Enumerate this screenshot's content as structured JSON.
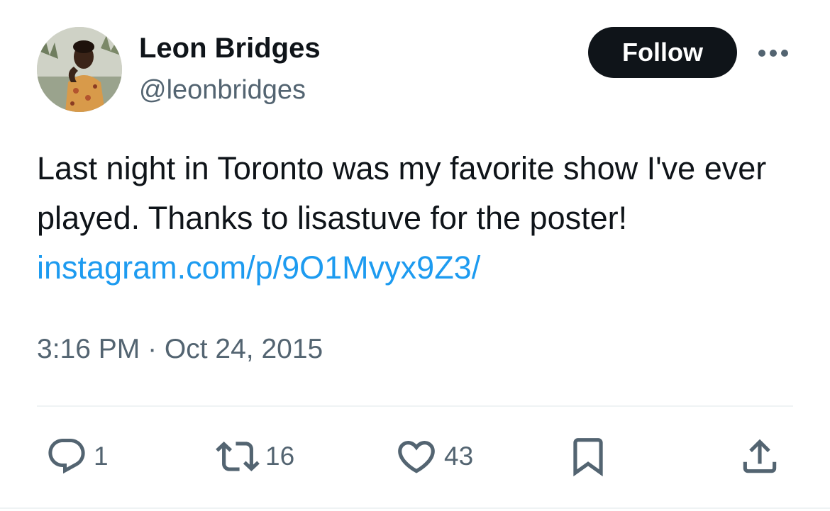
{
  "author": {
    "display_name": "Leon Bridges",
    "handle": "@leonbridges",
    "avatar_icon": "profile-photo"
  },
  "header": {
    "follow_label": "Follow",
    "more_icon": "ellipsis-icon"
  },
  "tweet": {
    "text": "Last night in Toronto was my favorite show I've ever played. Thanks to lisastuve for the poster! ",
    "link": "instagram.com/p/9O1Mvyx9Z3/",
    "timestamp": "3:16 PM · Oct 24, 2015"
  },
  "actions": {
    "reply": {
      "icon": "reply-icon",
      "count": "1"
    },
    "retweet": {
      "icon": "retweet-icon",
      "count": "16"
    },
    "like": {
      "icon": "heart-icon",
      "count": "43"
    },
    "bookmark": {
      "icon": "bookmark-icon"
    },
    "share": {
      "icon": "share-icon"
    }
  },
  "colors": {
    "text": "#0f1419",
    "secondary": "#536471",
    "link": "#1d9bf0",
    "button": "#0f1419",
    "divider": "#eff3f4"
  }
}
